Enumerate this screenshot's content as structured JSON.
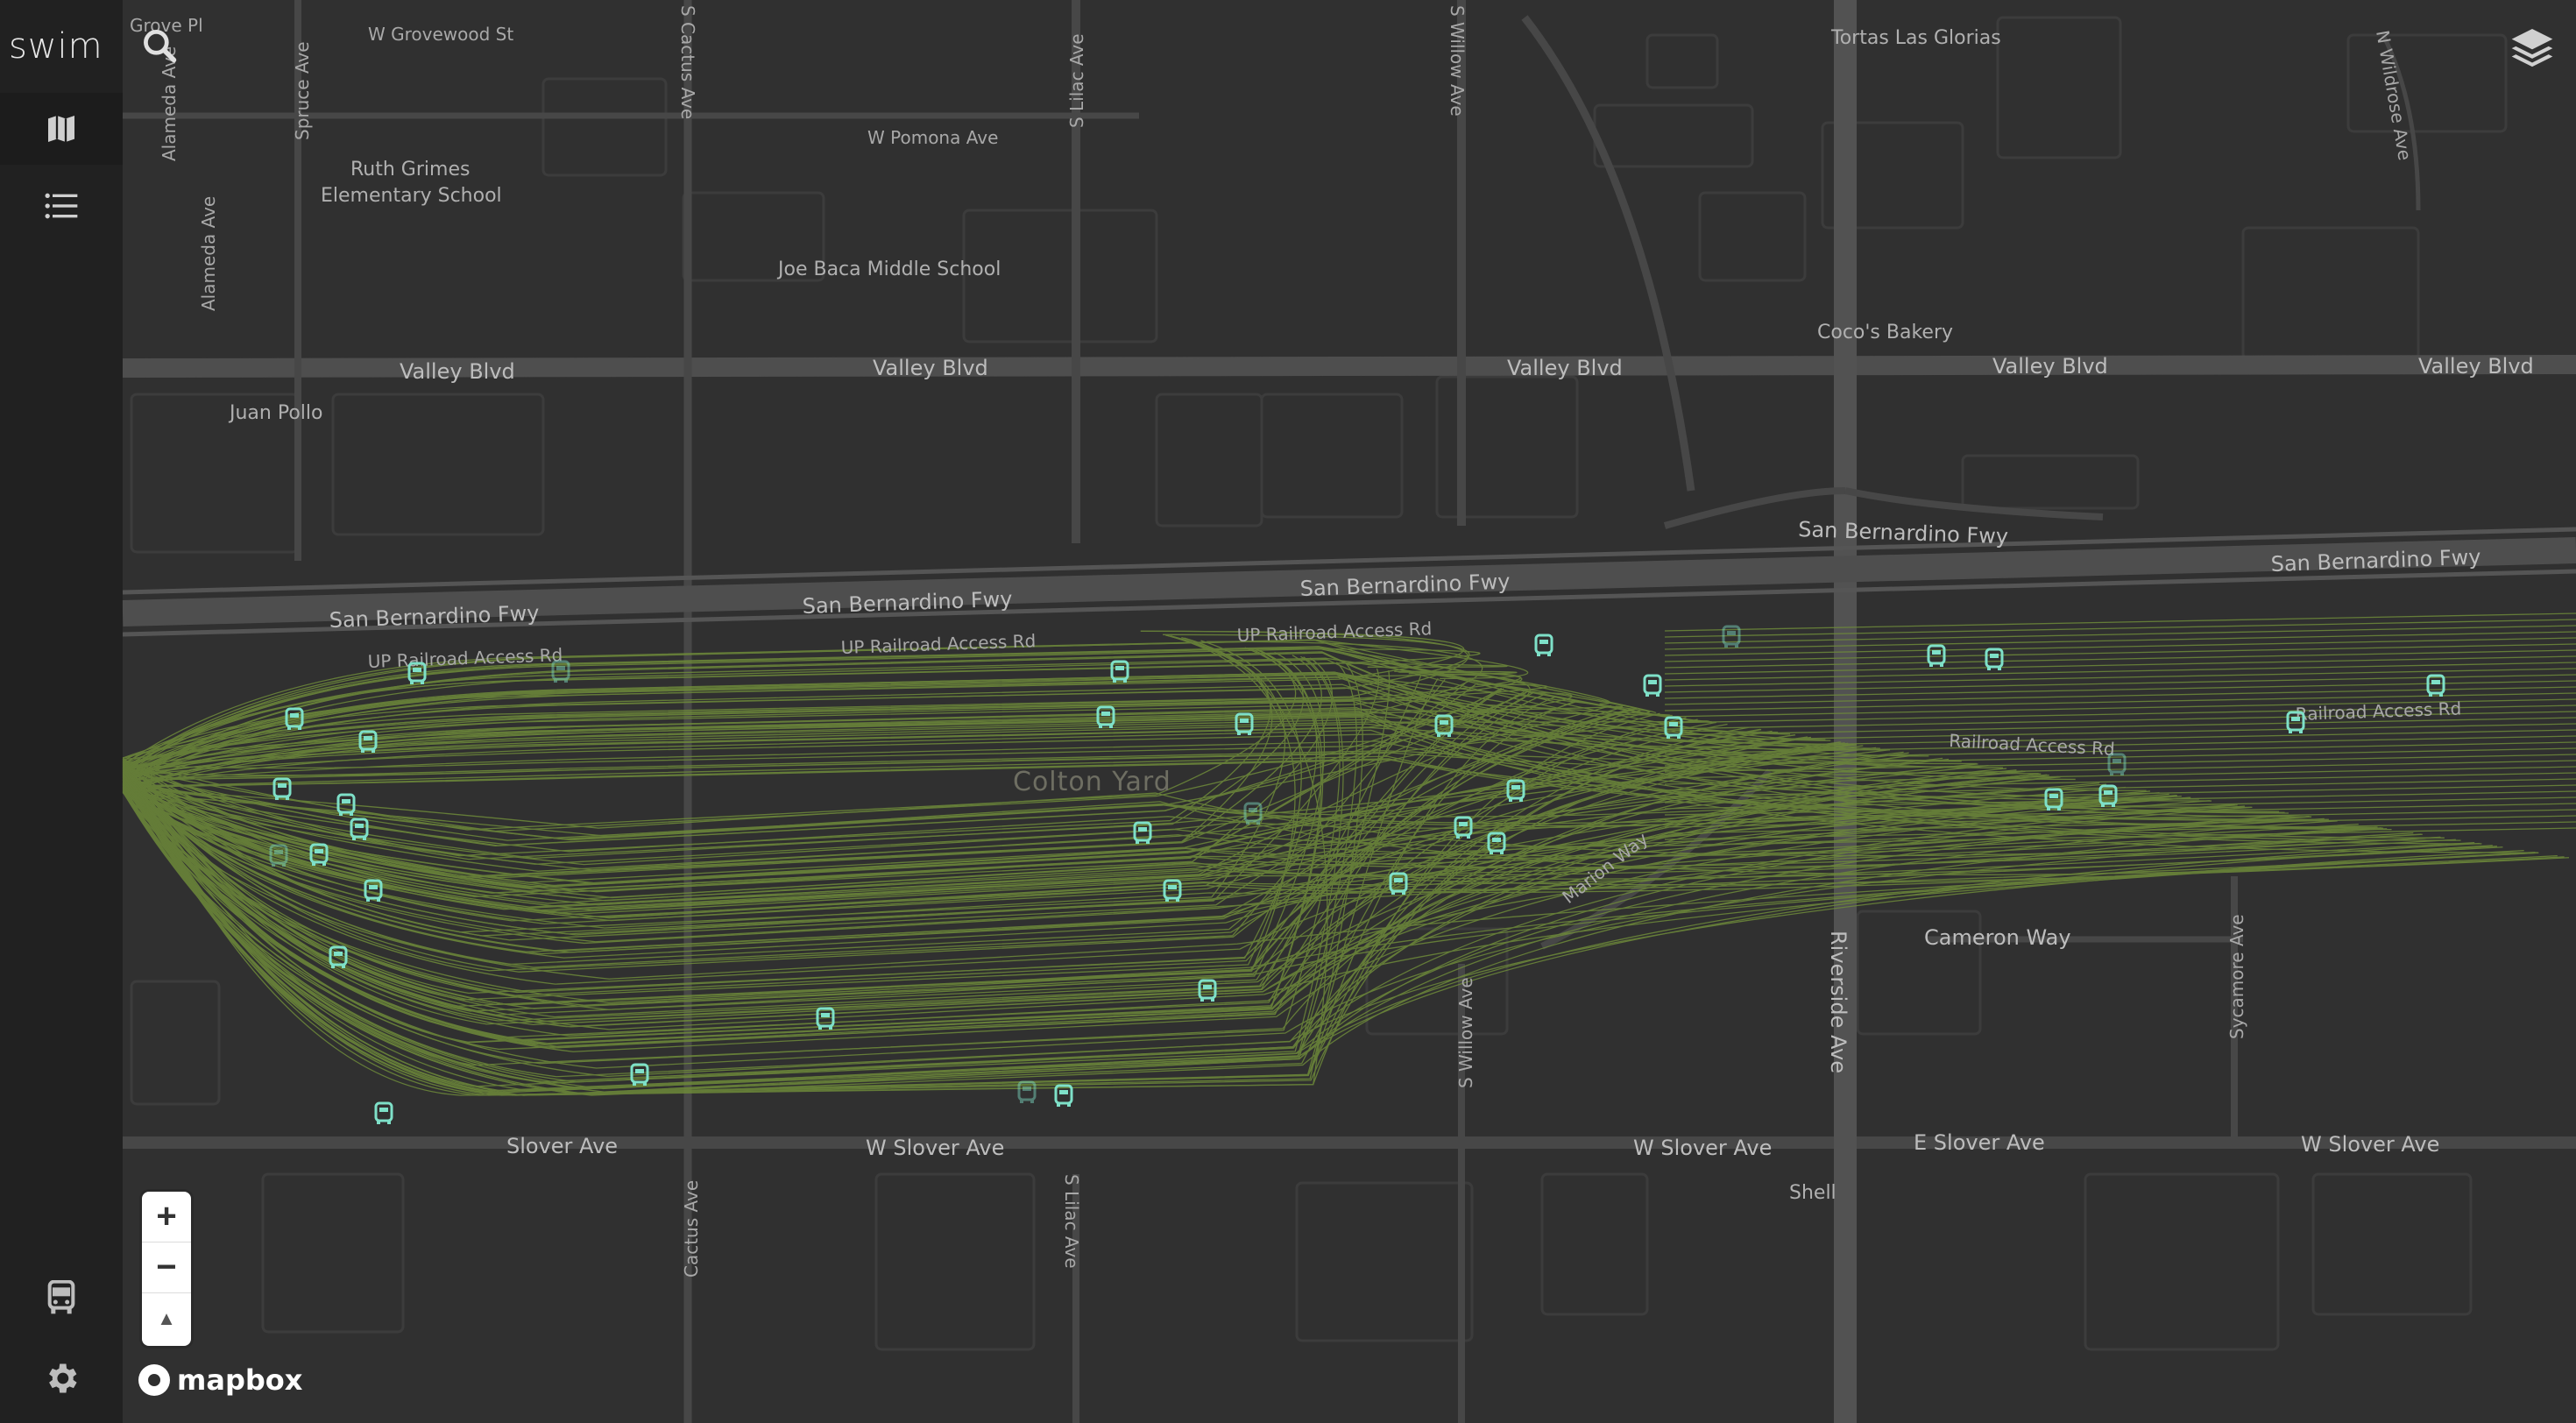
{
  "app": {
    "logo": "swim"
  },
  "sidebar": {
    "items": [
      {
        "name": "map-icon",
        "active": true
      },
      {
        "name": "list-icon",
        "active": false
      },
      {
        "name": "train-icon",
        "active": false
      },
      {
        "name": "gear-icon",
        "active": false
      }
    ]
  },
  "controls": {
    "zoom_in": "+",
    "zoom_out": "−",
    "compass": "▲",
    "search_icon": "search-icon",
    "layers_icon": "layers-icon"
  },
  "attribution": {
    "label": "mapbox"
  },
  "colors": {
    "background": "#303030",
    "road": "#4a4a4a",
    "road_major": "#525252",
    "track": "#6e8a3a",
    "vehicle": "#7ee0c8",
    "sidebar": "#1c1c1c"
  },
  "map": {
    "area_label": "Colton Yard",
    "street_labels": [
      "W Grovewood St",
      "Grove Pl",
      "Alameda Ave",
      "Spruce Ave",
      "S Cactus Ave",
      "S Lilac Ave",
      "S Willow Ave",
      "N Wildrose Ave",
      "W Pomona Ave",
      "Valley Blvd",
      "San Bernardino Fwy",
      "UP Railroad Access Rd",
      "Railroad Access Rd",
      "Marion Way",
      "Cameron Way",
      "Riverside Ave",
      "Sycamore Ave",
      "Slover Ave",
      "W Slover Ave",
      "E Slover Ave",
      "Cactus Ave"
    ],
    "poi_labels": [
      "Ruth Grimes Elementary School",
      "Joe Baca Middle School",
      "Juan Pollo",
      "Tortas Las Glorias",
      "Coco's Bakery",
      "Shell"
    ],
    "vehicle_count": 42
  }
}
